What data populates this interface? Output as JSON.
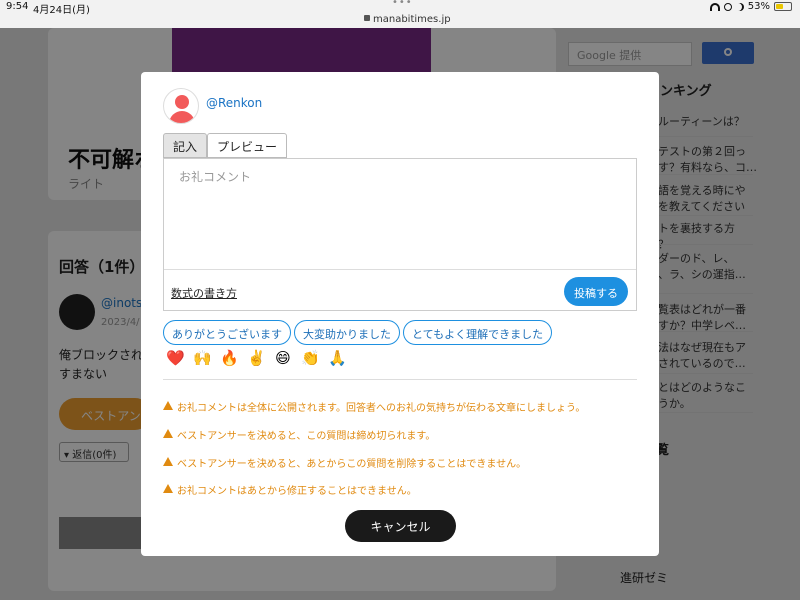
{
  "status": {
    "time": "9:54",
    "date": "4月24日(月)",
    "url": "manabitimes.jp",
    "battery": "53%",
    "battery_level": 0.53
  },
  "background": {
    "question_title": "不可解ホ",
    "question_sub": "ライト",
    "answers_heading": "回答（1件）",
    "answer_user": "@inots",
    "answer_date": "2023/4/",
    "answer_body_1": "俺ブロックされ",
    "answer_body_2": "すまない",
    "best_answer_label": "ベストアン",
    "reply_label": "返信(0件)",
    "search_placeholder": "Google 提供",
    "ranking_title": "ンキング",
    "ranking_items": [
      "ルーティーンは？",
      "テストの第２回っ\nす？有料なら、コ…",
      "語を覚える時にや\nを教えてください",
      "トを裏技する方\n？",
      "ダーのド、レ、\n、ラ、シの運指…",
      "覧表はどれが一番\nすか？中学レベ…",
      "法はなぜ現在もア\nされているので…",
      "とはどのようなこ\nうか。"
    ],
    "section2_heading": "覧",
    "zemi_label": "進研ゼミ"
  },
  "modal": {
    "username": "@Renkon",
    "tabs": [
      "記入",
      "プレビュー"
    ],
    "active_tab": 0,
    "comment_placeholder": "お礼コメント",
    "formula_link": "数式の書き方",
    "post_button": "投稿する",
    "quick_replies": [
      "ありがとうございます",
      "大変助かりました",
      "とてもよく理解できました"
    ],
    "reactions": [
      "❤️",
      "🙌",
      "🔥",
      "✌️",
      "😄",
      "👏",
      "🙏"
    ],
    "warnings": [
      "お礼コメントは全体に公開されます。回答者へのお礼の気持ちが伝わる文章にしましょう。",
      "ベストアンサーを決めると、この質問は締め切られます。",
      "ベストアンサーを決めると、あとからこの質問を削除することはできません。",
      "お礼コメントはあとから修正することはできません。"
    ],
    "cancel_button": "キャンセル"
  },
  "colors": {
    "accent": "#1e90e0",
    "warning": "#e08a10",
    "avatar": "#f25a5a",
    "cancel_bg": "#1a1a1a"
  }
}
